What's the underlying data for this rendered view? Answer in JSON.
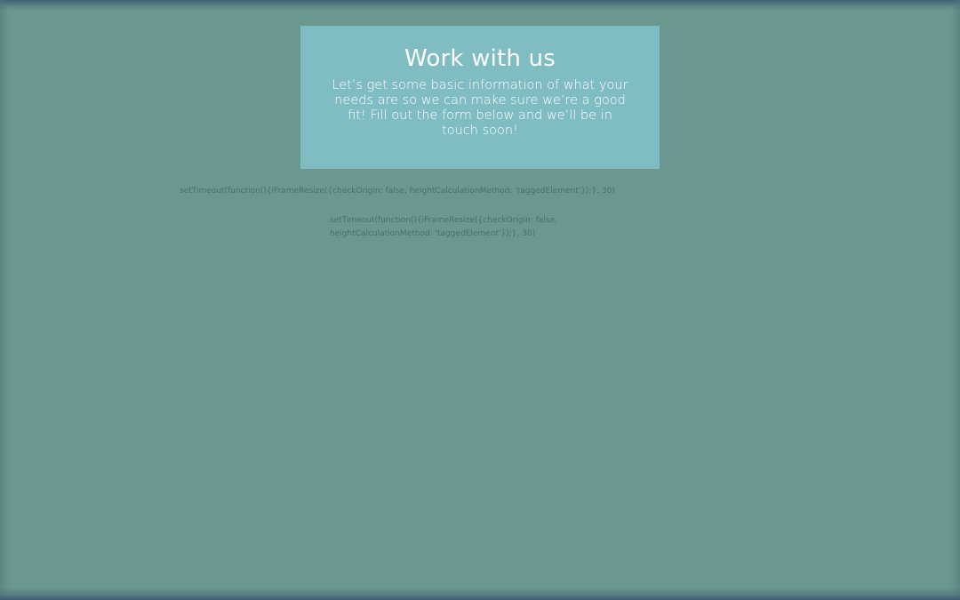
{
  "colors": {
    "page_background": "#6a978f",
    "card_background": "#7fbdc3",
    "card_text": "#ffffff",
    "code_text": "#4b6e69"
  },
  "hero": {
    "title": "Work with us",
    "description": "Let’s get some basic information of what your needs are so we can make sure we’re a good fit! Fill out the form below and we’ll be in touch soon!"
  },
  "script_text": {
    "line_1": "setTimeout(function(){iFrameResize({checkOrigin: false, heightCalculationMethod: 'taggedElement'});}, 30)",
    "line_2": "setTimeout(function(){iFrameResize({checkOrigin: false, heightCalculationMethod: 'taggedElement'});}, 30)"
  }
}
